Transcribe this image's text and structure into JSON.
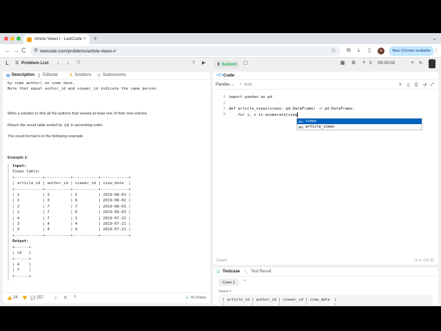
{
  "browser": {
    "tab_title": "Article Views I - LeetCode",
    "tab_close": "×",
    "new_tab": "+",
    "tab_menu": "⌄",
    "url": "leetcode.com/problems/article-views-i/",
    "back": "←",
    "forward": "→",
    "reload": "C",
    "bookmark": "☆",
    "profile_initial": "G",
    "new_chrome": "New Chrome available",
    "menu": "⋮"
  },
  "lcnav": {
    "problem_list": "Problem List",
    "prev": "‹",
    "next": "›",
    "shuffle": "⤨",
    "run": "▶",
    "submit": "Submit",
    "timer": "00:00:02",
    "fire_count": "0"
  },
  "left_tabs": {
    "description": "Description",
    "editorial": "Editorial",
    "solutions": "Solutions",
    "submissions": "Submissions"
  },
  "description": {
    "top_line_1": "by some author) on some date.",
    "top_line_2": "Note that equal author_id and viewer_id indicate the same person.",
    "task": "Write a solution to find all the authors that viewed at least one of their own articles.",
    "return_prefix": "Return the result table sorted by ",
    "return_code": "id",
    "return_suffix": " in ascending order.",
    "format": "The result format is in the following example.",
    "example_title": "Example 1:",
    "input_label": "Input:",
    "views_table_label": "Views table:",
    "views_table": "+------------+-----------+-----------+------------+\n| article_id | author_id | viewer_id | view_date  |\n+------------+-----------+-----------+------------+\n| 1          | 3         | 5         | 2019-08-01 |\n| 1          | 3         | 6         | 2019-08-02 |\n| 2          | 7         | 7         | 2019-08-01 |\n| 2          | 7         | 6         | 2019-08-02 |\n| 4          | 7         | 1         | 2019-07-22 |\n| 3          | 4         | 4         | 2019-07-21 |\n| 3          | 4         | 4         | 2019-07-21 |\n+------------+-----------+-----------+------------+",
    "output_label": "Output:",
    "output_table": "+------+\n| id   |\n+------+\n| 4    |\n| 7    |\n+------+"
  },
  "left_footer": {
    "likes": "2K",
    "comments": "257",
    "online": "76 Online"
  },
  "code_panel": {
    "title": "Code",
    "language": "Pandas",
    "auto": "Auto",
    "lines": [
      {
        "n": "1",
        "text": "import pandas as pd"
      },
      {
        "n": "2",
        "text": ""
      },
      {
        "n": "3",
        "text": "def article_views(views: pd.DataFrame) -> pd.DataFrame:"
      },
      {
        "n": "4",
        "text": "    for i, v in enumerate(view"
      }
    ],
    "suggestions": [
      "views",
      "article_views"
    ],
    "saved": "Saved",
    "cursor_pos": "Ln 4, Col 31"
  },
  "testcase": {
    "tab_testcase": "Testcase",
    "tab_result": "Test Result",
    "case_label": "Case 1",
    "add": "+",
    "views_label": "Views =",
    "table": "| article_id | author_id | viewer_id | view_date  |\n| ---------- | --------- | --------- | ---------- |\n| 1          | 3         | 5         | 2019-08-01 |\n| 1          | 3         | 6         | 2019-08-02 |"
  },
  "colors": {
    "traffic_red": "#ff5f57",
    "traffic_yellow": "#febc2e",
    "traffic_green": "#28c840",
    "submit_green": "#2db55d",
    "accent_blue": "#1a73e8",
    "suggest_selected": "#0060c0"
  }
}
